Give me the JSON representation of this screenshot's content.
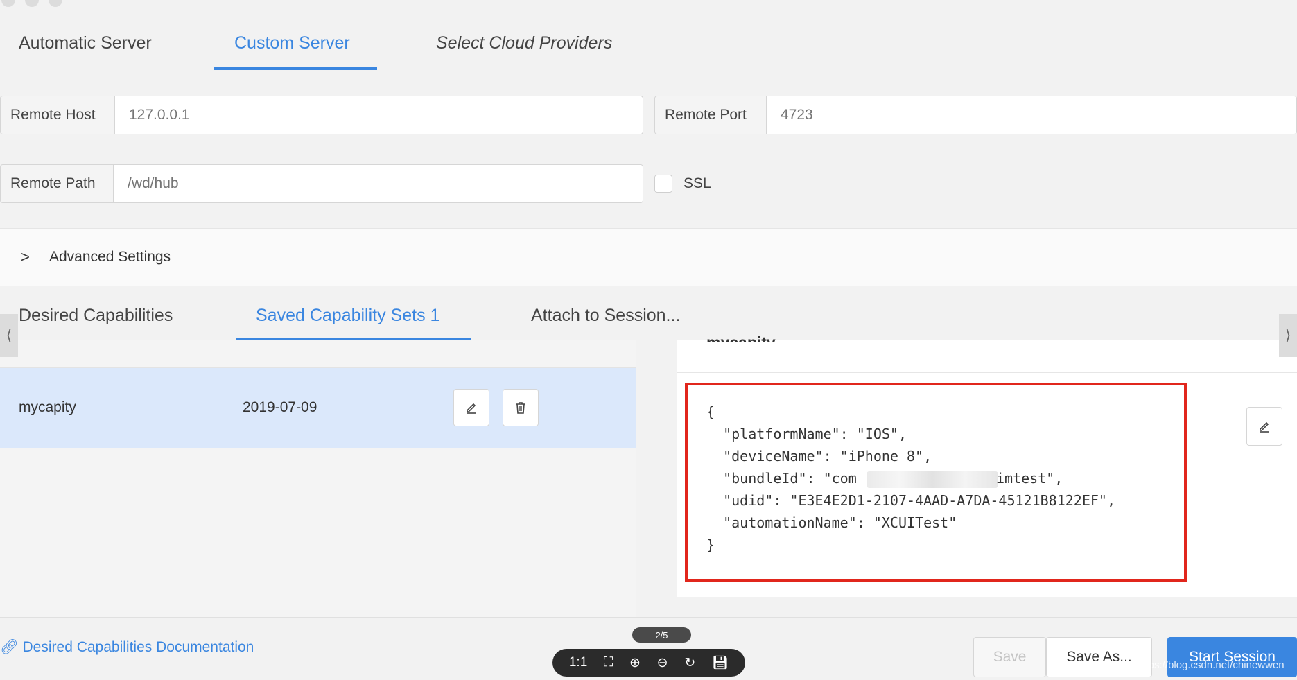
{
  "tabs": {
    "automatic": "Automatic Server",
    "custom": "Custom Server",
    "cloud": "Select Cloud Providers"
  },
  "server": {
    "remote_host_label": "Remote Host",
    "remote_host_placeholder": "127.0.0.1",
    "remote_port_label": "Remote Port",
    "remote_port_placeholder": "4723",
    "remote_path_label": "Remote Path",
    "remote_path_placeholder": "/wd/hub",
    "ssl_label": "SSL"
  },
  "advanced": {
    "label": "Advanced Settings"
  },
  "cap_tabs": {
    "desired": "Desired Capabilities",
    "saved": "Saved Capability Sets 1",
    "attach": "Attach to Session..."
  },
  "saved_list": {
    "rows": [
      {
        "name": "mycapity",
        "date": "2019-07-09"
      }
    ]
  },
  "detail": {
    "title": "mycapity",
    "code_lines": [
      "{",
      "  \"platformName\": \"IOS\",",
      "  \"deviceName\": \"iPhone 8\",",
      "  \"bundleId\": \"com",
      "imtest\",",
      "  \"udid\": \"E3E4E2D1-2107-4AAD-A7DA-45121B8122EF\",",
      "  \"automationName\": \"XCUITest\"",
      "}"
    ]
  },
  "footer": {
    "doc_link": "Desired Capabilities Documentation",
    "save": "Save",
    "save_as": "Save As...",
    "start": "Start Session",
    "page_indicator": "2/5",
    "watermark": "https://blog.csdn.net/chinewwen"
  },
  "viewer_toolbar": [
    "1:1",
    "fit-icon",
    "zoom-in-icon",
    "zoom-out-icon",
    "rotate-icon",
    "save-icon"
  ],
  "colors": {
    "accent": "#3a86e0",
    "highlight_box": "#e1261c",
    "selected_row": "#dbe8fb"
  }
}
